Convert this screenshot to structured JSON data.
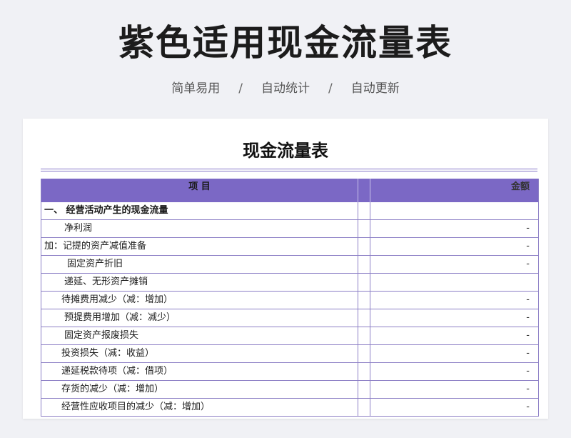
{
  "page": {
    "title": "紫色适用现金流量表",
    "subtitle": [
      "简单易用",
      "自动统计",
      "自动更新"
    ],
    "separator": "/"
  },
  "sheet": {
    "title": "现金流量表",
    "columns": {
      "item": "项 目",
      "amount": "金额"
    },
    "rows": [
      {
        "label": "一、 经营活动产生的现金流量",
        "amount": "",
        "indent": 4,
        "section": true
      },
      {
        "label": "净利润",
        "amount": "-",
        "indent": 32
      },
      {
        "label": "加：记提的资产减值准备",
        "amount": "-",
        "indent": 4
      },
      {
        "label": "固定资产折旧",
        "amount": "-",
        "indent": 36
      },
      {
        "label": "递延、无形资产摊销",
        "amount": "",
        "indent": 32
      },
      {
        "label": "待摊费用减少（减：增加）",
        "amount": "-",
        "indent": 28
      },
      {
        "label": "预提费用增加（减：减少）",
        "amount": "-",
        "indent": 32
      },
      {
        "label": "固定资产报废损失",
        "amount": "-",
        "indent": 32
      },
      {
        "label": "投资损失（减：收益）",
        "amount": "-",
        "indent": 28
      },
      {
        "label": "递延税款待项（减：借项）",
        "amount": "-",
        "indent": 28
      },
      {
        "label": "存货的减少（减：增加）",
        "amount": "-",
        "indent": 28
      },
      {
        "label": "经营性应收项目的减少（减：增加）",
        "amount": "-",
        "indent": 28
      }
    ]
  },
  "colors": {
    "accent": "#7b68c5",
    "grid": "#8d80c6",
    "background": "#f0f1f5"
  }
}
